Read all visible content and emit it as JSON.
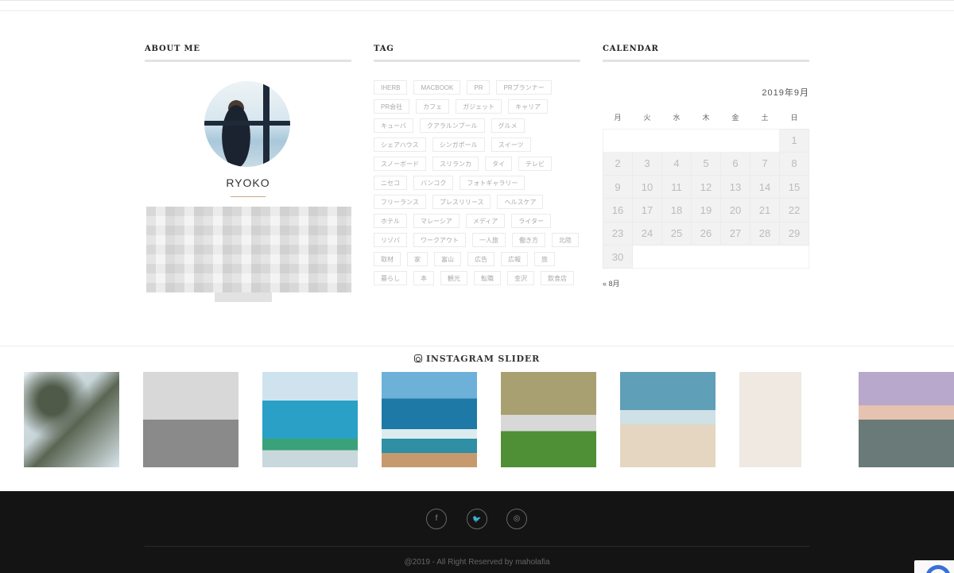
{
  "about": {
    "title": "ABOUT ME",
    "name": "RYOKO"
  },
  "tag": {
    "title": "TAG",
    "items": [
      "IHERB",
      "MACBOOK",
      "PR",
      "PRプランナー",
      "PR会社",
      "カフェ",
      "ガジェット",
      "キャリア",
      "キューバ",
      "クアラルンプール",
      "グルメ",
      "シェアハウス",
      "シンガポール",
      "スイーツ",
      "スノーボード",
      "スリランカ",
      "タイ",
      "テレビ",
      "ニセコ",
      "バンコク",
      "フォトギャラリー",
      "フリーランス",
      "プレスリリース",
      "ヘルスケア",
      "ホテル",
      "マレーシア",
      "メディア",
      "ライター",
      "リゾバ",
      "ワークアウト",
      "一人旅",
      "働き方",
      "北陸",
      "取材",
      "家",
      "富山",
      "広告",
      "広報",
      "旅",
      "暮らし",
      "本",
      "観光",
      "転職",
      "金沢",
      "飲食店"
    ]
  },
  "calendar": {
    "title": "CALENDAR",
    "caption": "2019年9月",
    "weekdays": [
      "月",
      "火",
      "水",
      "木",
      "金",
      "土",
      "日"
    ],
    "rows": [
      [
        "",
        "",
        "",
        "",
        "",
        "",
        "1"
      ],
      [
        "2",
        "3",
        "4",
        "5",
        "6",
        "7",
        "8"
      ],
      [
        "9",
        "10",
        "11",
        "12",
        "13",
        "14",
        "15"
      ],
      [
        "16",
        "17",
        "18",
        "19",
        "20",
        "21",
        "22"
      ],
      [
        "23",
        "24",
        "25",
        "26",
        "27",
        "28",
        "29"
      ],
      [
        "30",
        "",
        "",
        "",
        "",
        "",
        ""
      ]
    ],
    "prev_link": "« 8月"
  },
  "instagram": {
    "title": "INSTAGRAM SLIDER",
    "slides": [
      "tree-branches",
      "lighthouse",
      "bird-ocean-view",
      "ocean-waves",
      "park-tree",
      "beach-seagulls",
      "cafe-interior",
      "city-skyline-beach"
    ]
  },
  "footer": {
    "social": [
      {
        "name": "facebook",
        "glyph": "f"
      },
      {
        "name": "twitter",
        "glyph": "🐦"
      },
      {
        "name": "instagram",
        "glyph": "◎"
      }
    ],
    "copyright": "@2019 - All Right Reserved by maholafia"
  }
}
